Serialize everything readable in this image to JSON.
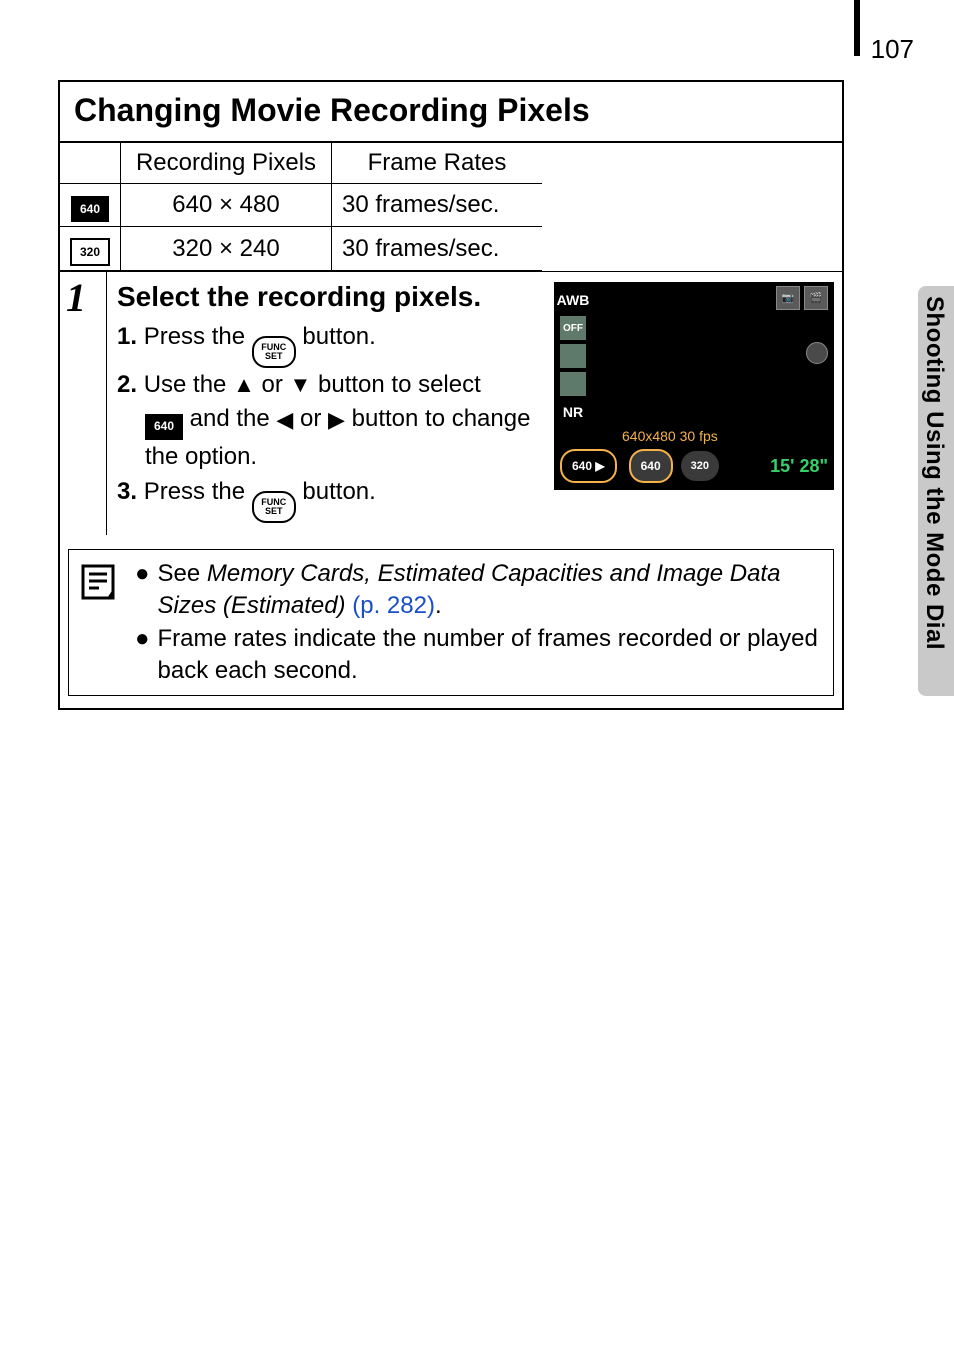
{
  "page_number": "107",
  "side_label": "Shooting Using the Mode Dial",
  "title": "Changing Movie Recording Pixels",
  "table": {
    "headers": [
      "",
      "Recording Pixels",
      "Frame Rates"
    ],
    "rows": [
      {
        "icon_label": "640",
        "pixels": "640 × 480",
        "rate": "30 frames/sec."
      },
      {
        "icon_label": "320",
        "pixels": "320 × 240",
        "rate": "30 frames/sec."
      }
    ]
  },
  "step": {
    "number": "1",
    "heading": "Select the recording pixels.",
    "sub1_prefix": "1.",
    "sub1_a": "Press the ",
    "sub1_b": " button.",
    "sub2_prefix": "2.",
    "sub2_a": "Use the ",
    "sub2_b": " or ",
    "sub2_c": " button to select ",
    "sub2_d": " and the ",
    "sub2_e": " or ",
    "sub2_f": " button to change the option.",
    "sub2_icon_label": "640",
    "sub3_prefix": "3.",
    "sub3_a": "Press the ",
    "sub3_b": " button.",
    "funcset_top": "FUNC",
    "funcset_bottom": "SET"
  },
  "camera": {
    "awb": "AWB",
    "off": "OFF",
    "nr": "NR",
    "hint": "640x480  30 fps",
    "sel_left": "640",
    "sel_mid": "640",
    "sel_right": "320",
    "time": "15' 28\""
  },
  "notes": {
    "n1_a": "See ",
    "n1_italic": "Memory Cards, Estimated Capacities and Image Data Sizes (Estimated)",
    "n1_link": " (p. 282)",
    "n1_end": ".",
    "n2": "Frame rates indicate the number of frames recorded or played back each second."
  }
}
